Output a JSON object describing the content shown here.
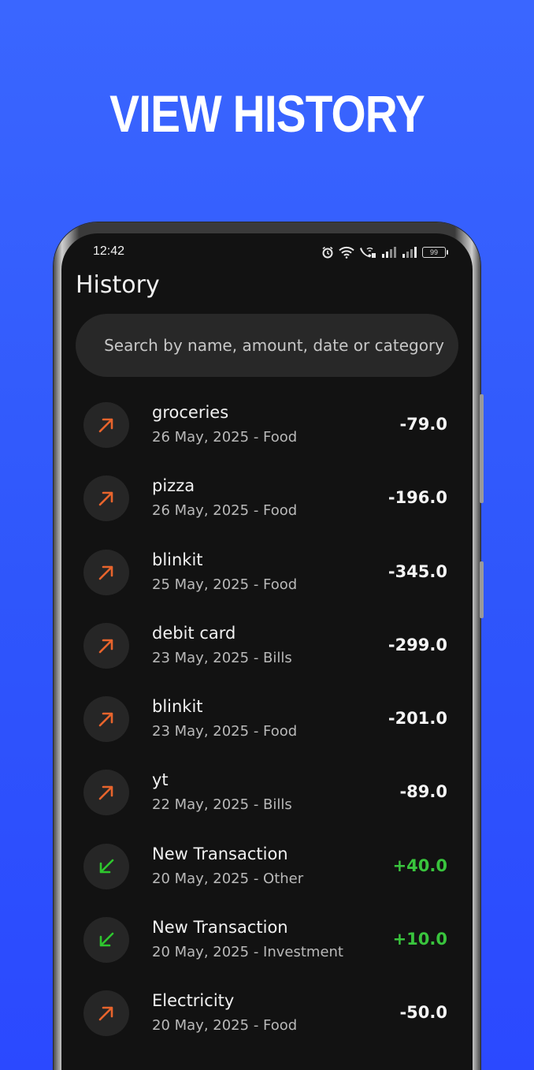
{
  "promo": {
    "headline": "VIEW HISTORY"
  },
  "status_bar": {
    "time": "12:42",
    "battery": "99",
    "icons": [
      "alarm-icon",
      "wifi-icon",
      "wifi-call-icon",
      "signal-icon",
      "signal-icon",
      "battery-icon"
    ]
  },
  "page": {
    "title": "History"
  },
  "search": {
    "placeholder": "Search by name, amount, date or category"
  },
  "colors": {
    "background": "#3366ff",
    "screen": "#121212",
    "expense_icon": "#e8642c",
    "income_icon": "#2ec72e",
    "income_amount": "#39c43d"
  },
  "transactions": [
    {
      "name": "groceries",
      "meta": "26 May, 2025 - Food",
      "amount": "-79.0",
      "type": "expense",
      "icon": "arrow-up-right-icon"
    },
    {
      "name": "pizza",
      "meta": "26 May, 2025 - Food",
      "amount": "-196.0",
      "type": "expense",
      "icon": "arrow-up-right-icon"
    },
    {
      "name": "blinkit",
      "meta": "25 May, 2025 - Food",
      "amount": "-345.0",
      "type": "expense",
      "icon": "arrow-up-right-icon"
    },
    {
      "name": "debit card",
      "meta": "23 May, 2025 - Bills",
      "amount": "-299.0",
      "type": "expense",
      "icon": "arrow-up-right-icon"
    },
    {
      "name": "blinkit",
      "meta": "23 May, 2025 - Food",
      "amount": "-201.0",
      "type": "expense",
      "icon": "arrow-up-right-icon"
    },
    {
      "name": "yt",
      "meta": "22 May, 2025 - Bills",
      "amount": "-89.0",
      "type": "expense",
      "icon": "arrow-up-right-icon"
    },
    {
      "name": "New Transaction",
      "meta": "20 May, 2025 - Other",
      "amount": "+40.0",
      "type": "income",
      "icon": "arrow-down-left-icon"
    },
    {
      "name": "New Transaction",
      "meta": "20 May, 2025 - Investment",
      "amount": "+10.0",
      "type": "income",
      "icon": "arrow-down-left-icon"
    },
    {
      "name": "Electricity",
      "meta": "20 May, 2025 - Food",
      "amount": "-50.0",
      "type": "expense",
      "icon": "arrow-up-right-icon"
    }
  ]
}
